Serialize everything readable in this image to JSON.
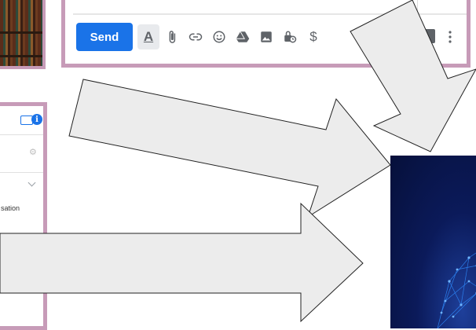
{
  "compose": {
    "send_label": "Send",
    "tools": [
      {
        "icon": "format-text-icon",
        "glyph": "A"
      },
      {
        "icon": "attach-icon"
      },
      {
        "icon": "link-icon"
      },
      {
        "icon": "emoji-icon"
      },
      {
        "icon": "drive-icon"
      },
      {
        "icon": "photo-icon"
      },
      {
        "icon": "confidential-mode-icon"
      },
      {
        "icon": "money-icon",
        "glyph": "$"
      }
    ]
  },
  "chat": {
    "info_glyph": "i",
    "snippet": "sation"
  },
  "colors": {
    "frame": "#c79bb8",
    "send": "#1a73e8",
    "arrow_fill": "#ececec",
    "neural_bg": "#0b1a5a",
    "neural_dots": "#2f8cff"
  }
}
